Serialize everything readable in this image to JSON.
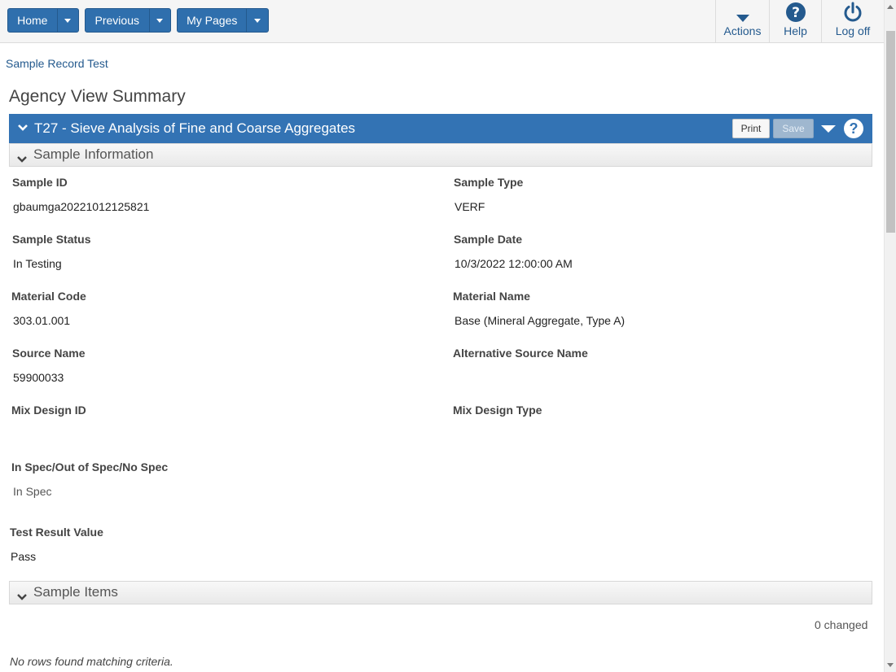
{
  "nav": {
    "home_label": "Home",
    "previous_label": "Previous",
    "mypages_label": "My Pages",
    "actions_label": "Actions",
    "help_label": "Help",
    "logoff_label": "Log off"
  },
  "breadcrumb": "Sample Record Test",
  "page_title": "Agency View Summary",
  "panel": {
    "title": "T27 - Sieve Analysis of Fine and Coarse Aggregates",
    "print_label": "Print",
    "save_label": "Save"
  },
  "sample_information": {
    "heading": "Sample Information",
    "fields": {
      "sample_id": {
        "label": "Sample ID",
        "value": "gbaumga20221012125821"
      },
      "sample_type": {
        "label": "Sample Type",
        "value": "VERF"
      },
      "sample_status": {
        "label": "Sample Status",
        "value": "In Testing"
      },
      "sample_date": {
        "label": "Sample Date",
        "value": "10/3/2022 12:00:00 AM"
      },
      "material_code": {
        "label": "Material Code",
        "value": "303.01.001"
      },
      "material_name": {
        "label": "Material Name",
        "value": "Base (Mineral Aggregate, Type A)"
      },
      "source_name": {
        "label": "Source Name",
        "value": "59900033"
      },
      "alt_source_name": {
        "label": "Alternative Source Name",
        "value": ""
      },
      "mix_design_id": {
        "label": "Mix Design ID",
        "value": ""
      },
      "mix_design_type": {
        "label": "Mix Design Type",
        "value": ""
      },
      "spec": {
        "label": "In Spec/Out of Spec/No Spec",
        "value": "In Spec"
      },
      "test_result": {
        "label": "Test Result Value",
        "value": "Pass"
      }
    }
  },
  "sample_items": {
    "heading": "Sample Items",
    "changed_text": "0 changed",
    "empty_text": "No rows found matching criteria."
  },
  "colors": {
    "accent": "#3373b4",
    "nav_button": "#2f6fad",
    "link": "#245a8e"
  }
}
